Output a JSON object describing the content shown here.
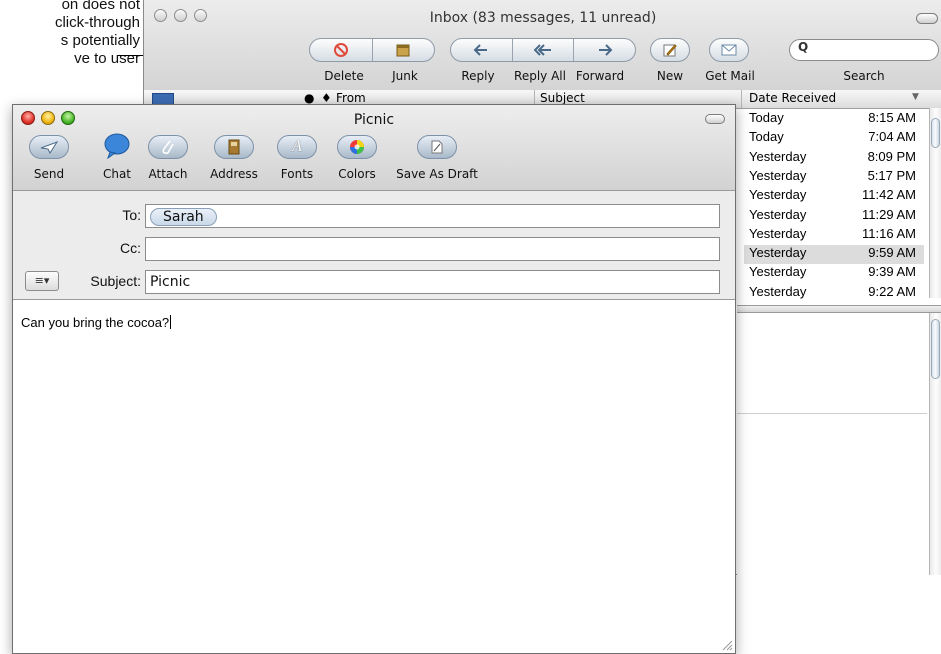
{
  "annotation": {
    "lines": [
      "on does not",
      "click-through",
      "s potentially",
      "ve to user"
    ]
  },
  "inbox": {
    "title": "Inbox (83 messages, 11 unread)",
    "toolbar": {
      "delete_label": "Delete",
      "junk_label": "Junk",
      "reply_label": "Reply",
      "reply_all_label": "Reply All",
      "forward_label": "Forward",
      "new_label": "New",
      "get_mail_label": "Get Mail",
      "search_label": "Search",
      "search_glyph": "Q"
    },
    "columns": {
      "from": "From",
      "subject": "Subject",
      "date_received": "Date Received",
      "sort_arrow": "▼"
    },
    "rows": [
      {
        "day": "Today",
        "time": "8:15 AM",
        "selected": false
      },
      {
        "day": "Today",
        "time": "7:04 AM",
        "selected": false
      },
      {
        "day": "Yesterday",
        "time": "8:09 PM",
        "selected": false
      },
      {
        "day": "Yesterday",
        "time": "5:17 PM",
        "selected": false
      },
      {
        "day": "Yesterday",
        "time": "11:42 AM",
        "selected": false
      },
      {
        "day": "Yesterday",
        "time": "11:29 AM",
        "selected": false
      },
      {
        "day": "Yesterday",
        "time": "11:16 AM",
        "selected": false
      },
      {
        "day": "Yesterday",
        "time": "9:59 AM",
        "selected": true
      },
      {
        "day": "Yesterday",
        "time": "9:39 AM",
        "selected": false
      },
      {
        "day": "Yesterday",
        "time": "9:22 AM",
        "selected": false
      }
    ]
  },
  "compose": {
    "title": "Picnic",
    "toolbar": {
      "send": "Send",
      "chat": "Chat",
      "attach": "Attach",
      "address": "Address",
      "fonts": "Fonts",
      "colors": "Colors",
      "save_as_draft": "Save As Draft"
    },
    "to_label": "To:",
    "to_value": "Sarah",
    "cc_label": "Cc:",
    "cc_value": "",
    "subject_label": "Subject:",
    "subject_value": "Picnic",
    "account_menu_glyph": "≡▾",
    "body": "Can you bring the cocoa?"
  },
  "colors": {
    "selected_row": "#dcdcdc",
    "close_red": "#e0352b",
    "minimize_yellow": "#f1b818",
    "zoom_green": "#4bb82b"
  }
}
